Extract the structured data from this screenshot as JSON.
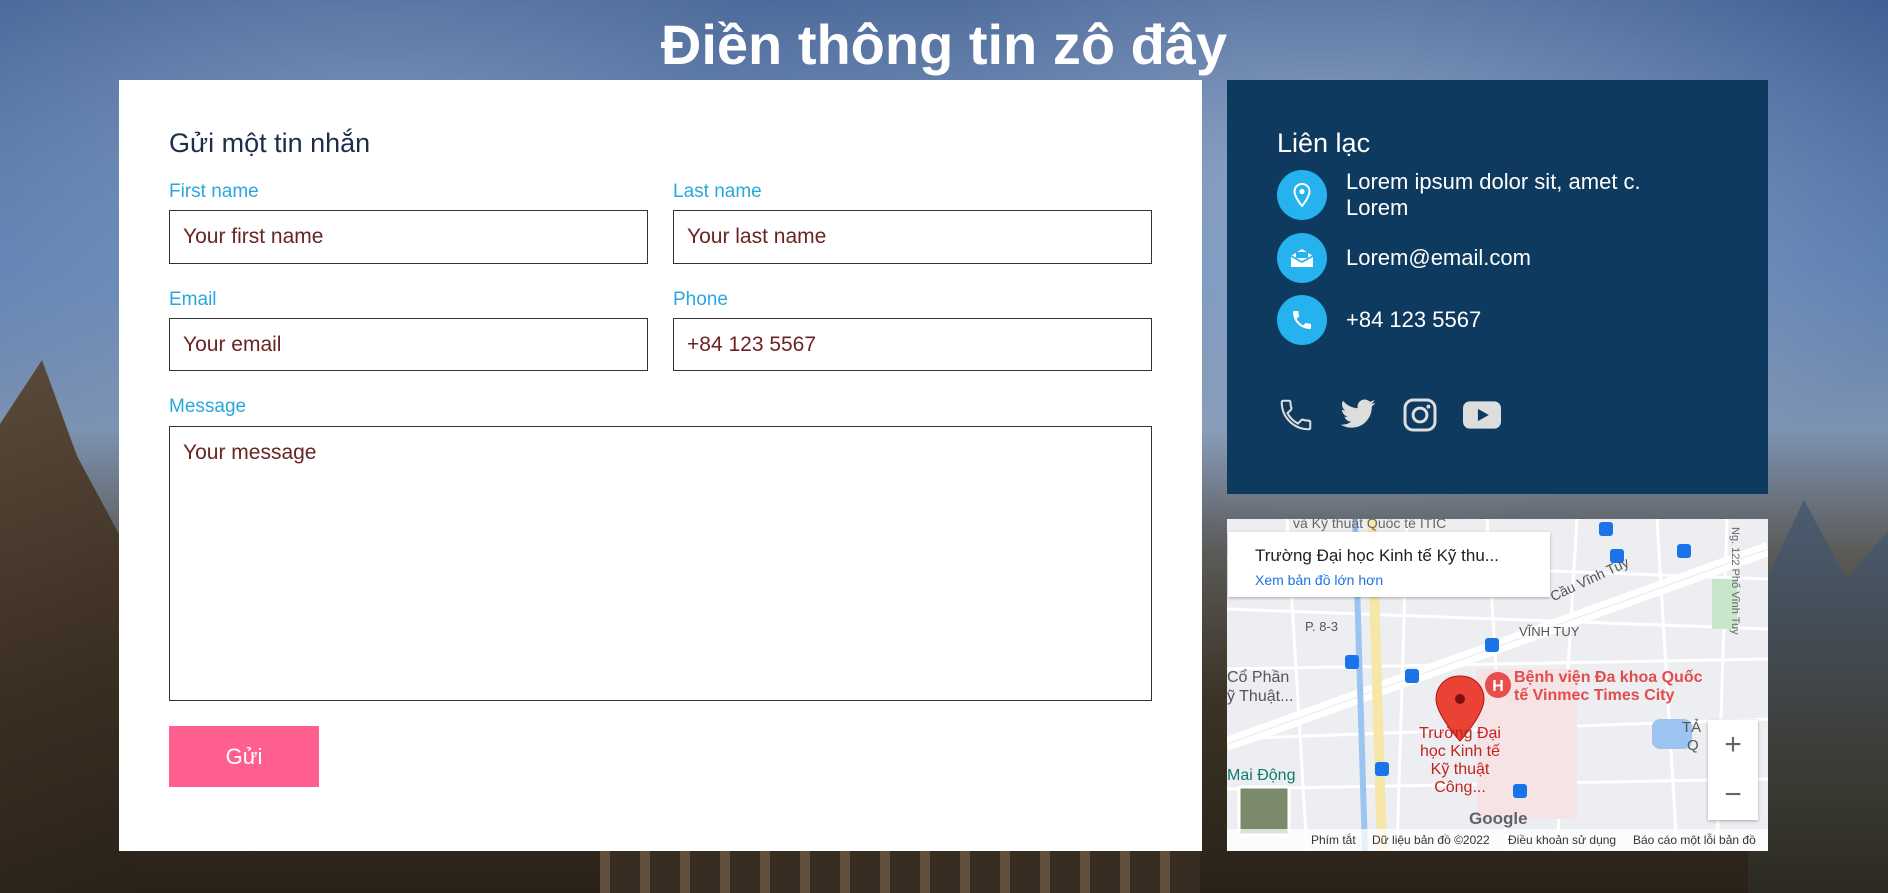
{
  "page": {
    "title": "Điền thông tin zô đây"
  },
  "form": {
    "heading": "Gửi một tin nhắn",
    "first_name": {
      "label": "First name",
      "placeholder": "Your first name"
    },
    "last_name": {
      "label": "Last name",
      "placeholder": "Your last name"
    },
    "email": {
      "label": "Email",
      "placeholder": "Your email"
    },
    "phone": {
      "label": "Phone",
      "placeholder": "+84 123 5567"
    },
    "message": {
      "label": "Message",
      "placeholder": "Your message"
    },
    "submit_label": "Gửi"
  },
  "contact": {
    "heading": "Liên lạc",
    "address": "Lorem ipsum dolor sit, amet c. Lorem",
    "email": "Lorem@email.com",
    "phone": "+84 123 5567",
    "address_icon": "location-pin-icon",
    "email_icon": "envelope-icon",
    "phone_icon": "phone-icon",
    "socials": [
      "phone-icon",
      "twitter-icon",
      "instagram-icon",
      "youtube-icon"
    ],
    "icon_color": "#26b1ef",
    "background": "#0e3a5f"
  },
  "map": {
    "place_title": "Trường Đại học Kinh tế Kỹ thu...",
    "larger_map_link": "Xem bản đồ lớn hơn",
    "labels": {
      "cau_vinh_tuy": "Cầu Vĩnh Tuy",
      "p83": "P. 8-3",
      "vinh_tuy": "VĨNH TUY",
      "co_phan": "Cổ Phần",
      "ky_thuat": "ỹ Thuật...",
      "hospital": "Bệnh viện Đa khoa Quốc tế Vinmec Times City",
      "pin_label": "Trường Đại học Kinh tế Kỹ thuật Công...",
      "mai_dong": "Mai Động",
      "road_122": "Ng. 122 Phố Vĩnh Tuy",
      "top_cut": "và Kỹ thuật Quốc tế ITIC",
      "ta": "TẢ",
      "q": "Q"
    },
    "zoom_in": "+",
    "zoom_out": "−",
    "google": "Google",
    "footer": {
      "shortcuts": "Phím tắt",
      "data": "Dữ liệu bản đồ ©2022",
      "terms": "Điều khoản sử dụng",
      "report": "Báo cáo một lỗi bản đồ"
    }
  },
  "colors": {
    "label": "#2aa7dd",
    "button": "#ff5f8f",
    "input_text": "#6a2424"
  }
}
